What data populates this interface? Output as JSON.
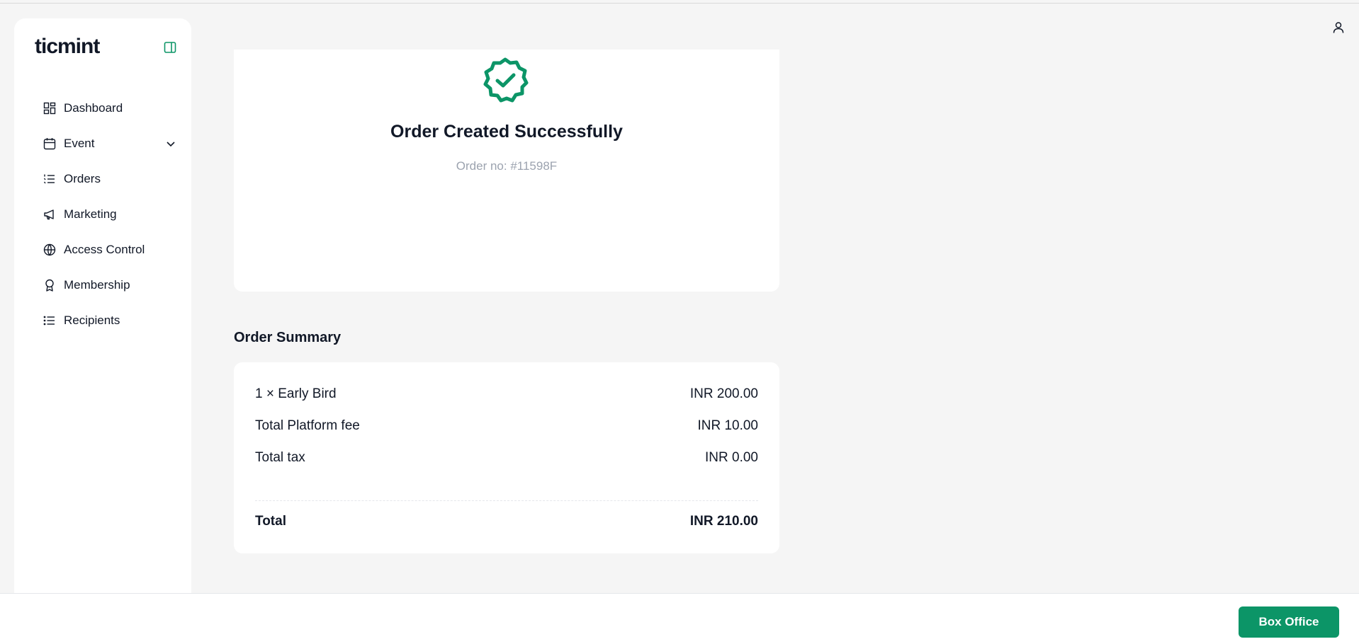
{
  "brand": {
    "logo": "ticmint",
    "accent": "#0c9567"
  },
  "sidebar": {
    "items": [
      {
        "label": "Dashboard",
        "icon": "dashboard-grid-icon"
      },
      {
        "label": "Event",
        "icon": "calendar-icon",
        "expandable": true
      },
      {
        "label": "Orders",
        "icon": "ordered-list-icon"
      },
      {
        "label": "Marketing",
        "icon": "megaphone-icon"
      },
      {
        "label": "Access Control",
        "icon": "globe-icon"
      },
      {
        "label": "Membership",
        "icon": "award-icon"
      },
      {
        "label": "Recipients",
        "icon": "list-icon"
      }
    ]
  },
  "success": {
    "title": "Order Created Successfully",
    "order_no": "Order no: #11598F"
  },
  "summary": {
    "heading": "Order Summary",
    "rows": [
      {
        "label": "1 × Early Bird",
        "value": "INR 200.00"
      },
      {
        "label": "Total Platform fee",
        "value": "INR 10.00"
      },
      {
        "label": "Total tax",
        "value": "INR 0.00"
      }
    ],
    "total": {
      "label": "Total",
      "value": "INR 210.00"
    }
  },
  "footer": {
    "button_label": "Box Office"
  }
}
